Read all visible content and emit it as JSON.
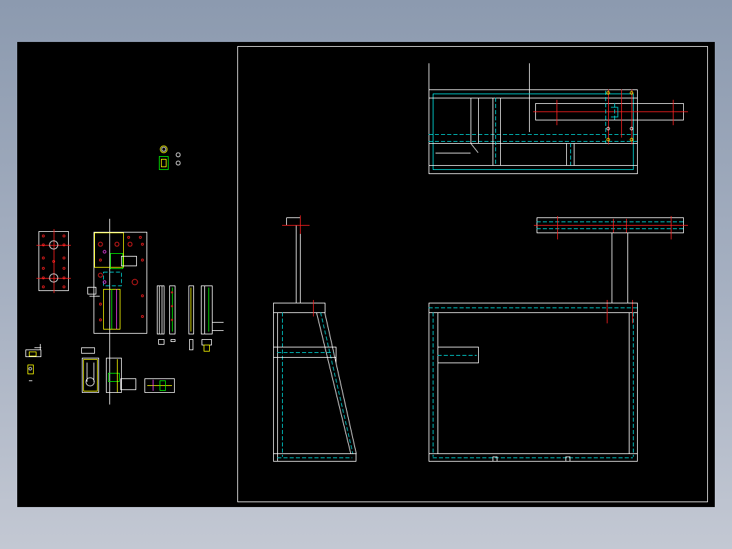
{
  "viewer": {
    "background": "#000000",
    "colors": {
      "outline": "#ffffff",
      "hidden": "#00e5e5",
      "center": "#ff2020",
      "dim": "#ffff00",
      "green": "#00ff00",
      "magenta": "#ff40ff"
    },
    "drawing": {
      "sheet_frame": "border",
      "views": [
        "top-view",
        "side-view",
        "front-view"
      ],
      "detail_views": [
        "mounting-plate",
        "bracket-assembly",
        "rail-parts",
        "base-block",
        "small-parts"
      ]
    }
  }
}
